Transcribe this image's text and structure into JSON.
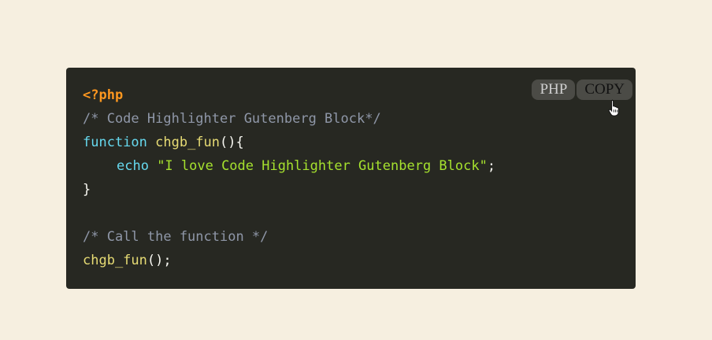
{
  "toolbar": {
    "language_label": "PHP",
    "copy_label": "COPY"
  },
  "code": {
    "lines": [
      [
        {
          "cls": "tok-php",
          "text": "<?php"
        }
      ],
      [
        {
          "cls": "tok-comment",
          "text": "/* Code Highlighter Gutenberg Block*/"
        }
      ],
      [
        {
          "cls": "tok-kw",
          "text": "function "
        },
        {
          "cls": "tok-fn",
          "text": "chgb_fun"
        },
        {
          "cls": "tok-punct",
          "text": "(){"
        }
      ],
      [
        {
          "cls": "indent",
          "text": ""
        },
        {
          "cls": "tok-kw",
          "text": "echo "
        },
        {
          "cls": "tok-str",
          "text": "\"I love Code Highlighter Gutenberg Block\""
        },
        {
          "cls": "tok-punct",
          "text": ";"
        }
      ],
      [
        {
          "cls": "tok-punct",
          "text": "}"
        }
      ],
      [],
      [
        {
          "cls": "tok-comment",
          "text": "/* Call the function */"
        }
      ],
      [
        {
          "cls": "tok-fn",
          "text": "chgb_fun"
        },
        {
          "cls": "tok-punct",
          "text": "();"
        }
      ]
    ]
  },
  "colors": {
    "background": "#f6efe0",
    "code_background": "#272822",
    "php_tag": "#fd971f",
    "comment": "#8f97a8",
    "keyword": "#66d9ef",
    "function_name": "#e6db74",
    "string": "#a6e22e",
    "badge_background": "#4b4b46"
  },
  "icons": {
    "cursor": "hand-pointer-icon"
  }
}
